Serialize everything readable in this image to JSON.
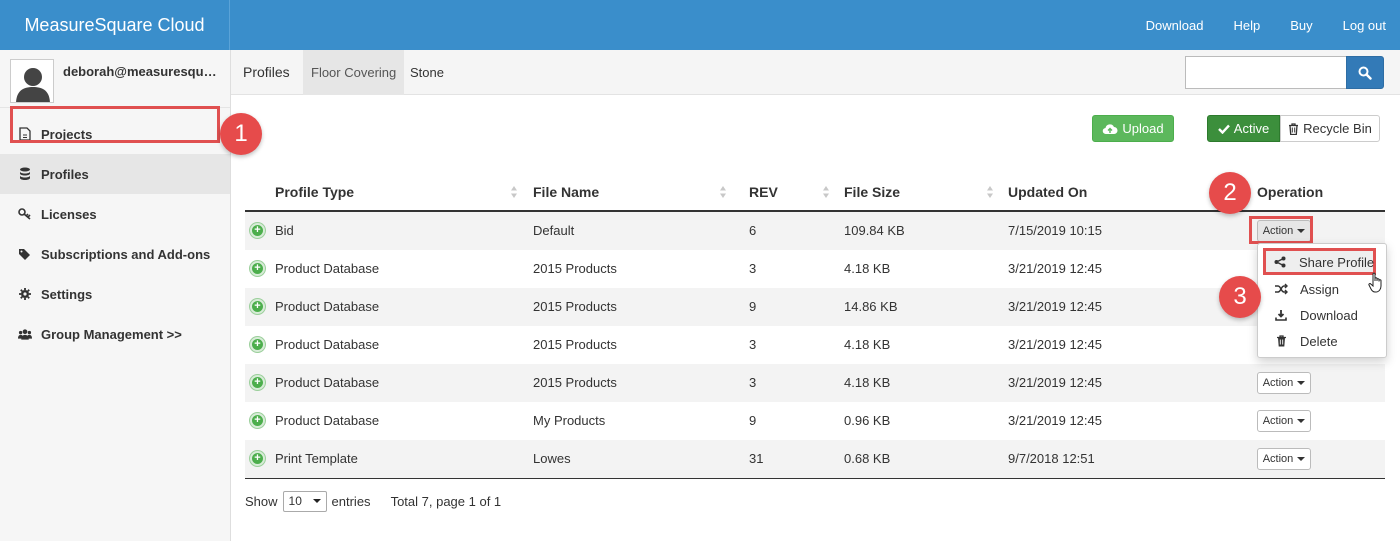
{
  "app": {
    "title": "MeasureSquare Cloud"
  },
  "topnav": [
    "Download",
    "Help",
    "Buy",
    "Log out"
  ],
  "user": {
    "email": "deborah@measuresquar..."
  },
  "sidebar": {
    "items": [
      {
        "label": "Projects",
        "icon": "file-icon"
      },
      {
        "label": "Profiles",
        "icon": "database-icon"
      },
      {
        "label": "Licenses",
        "icon": "key-icon"
      },
      {
        "label": "Subscriptions and Add-ons",
        "icon": "tags-icon"
      },
      {
        "label": "Settings",
        "icon": "gear-icon"
      },
      {
        "label": "Group Management >>",
        "icon": "group-icon"
      }
    ]
  },
  "subtabs": {
    "current": "Profiles",
    "tabs": [
      "Floor Covering",
      "Stone"
    ]
  },
  "search": {
    "value": "",
    "placeholder": ""
  },
  "toolbar": {
    "upload": "Upload",
    "active": "Active",
    "recycle": "Recycle Bin"
  },
  "table": {
    "columns": [
      "Profile Type",
      "File Name",
      "REV",
      "File Size",
      "Updated On",
      "Operation"
    ],
    "rows": [
      {
        "type": "Bid",
        "file": "Default",
        "rev": "6",
        "size": "109.84 KB",
        "updated": "7/15/2019 10:15",
        "action": "Action"
      },
      {
        "type": "Product Database",
        "file": "2015 Products",
        "rev": "3",
        "size": "4.18 KB",
        "updated": "3/21/2019 12:45",
        "action": "Action"
      },
      {
        "type": "Product Database",
        "file": "2015 Products",
        "rev": "9",
        "size": "14.86 KB",
        "updated": "3/21/2019 12:45",
        "action": "Action"
      },
      {
        "type": "Product Database",
        "file": "2015 Products",
        "rev": "3",
        "size": "4.18 KB",
        "updated": "3/21/2019 12:45",
        "action": "Action"
      },
      {
        "type": "Product Database",
        "file": "2015 Products",
        "rev": "3",
        "size": "4.18 KB",
        "updated": "3/21/2019 12:45",
        "action": "Action"
      },
      {
        "type": "Product Database",
        "file": "My Products",
        "rev": "9",
        "size": "0.96 KB",
        "updated": "3/21/2019 12:45",
        "action": "Action"
      },
      {
        "type": "Print Template",
        "file": "Lowes",
        "rev": "31",
        "size": "0.68 KB",
        "updated": "9/7/2018 12:51",
        "action": "Action"
      }
    ]
  },
  "dropdown": {
    "items": [
      "Share Profile",
      "Assign",
      "Download",
      "Delete"
    ]
  },
  "callouts": [
    "1",
    "2",
    "3"
  ],
  "footer": {
    "show": "Show",
    "length": "10",
    "entries": "entries",
    "totals": "Total 7, page 1 of 1"
  },
  "colors": {
    "topbar": "#3a8ecb",
    "upload": "#5cb85c",
    "active": "#3c8f3c",
    "search": "#337ab7",
    "callout": "#e64b4b"
  }
}
